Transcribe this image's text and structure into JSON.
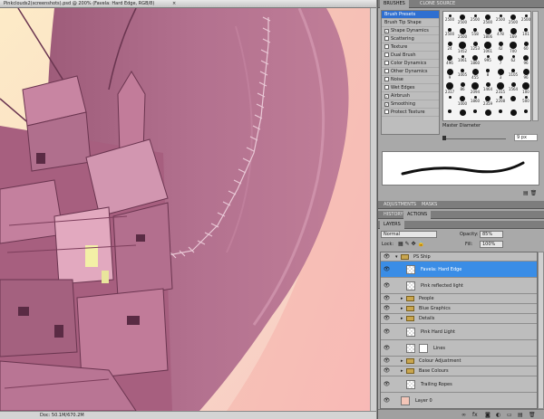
{
  "document": {
    "title": "Pinkclouds2(screenshots).psd @ 200% (Favela: Hard Edge, RGB/8)",
    "close": "×",
    "status_zoom": "",
    "status_doc": "Doc: 50.1M/670.2M"
  },
  "brushes_panel": {
    "tabs": [
      "BRUSHES",
      "CLONE SOURCE"
    ],
    "options": [
      {
        "label": "Brush Presets",
        "selected": true,
        "checkbox": false
      },
      {
        "label": "Brush Tip Shape",
        "checkbox": false
      },
      {
        "label": "Shape Dynamics",
        "checked": true,
        "checkbox": true
      },
      {
        "label": "Scattering",
        "checked": false,
        "checkbox": true
      },
      {
        "label": "Texture",
        "checked": false,
        "checkbox": true
      },
      {
        "label": "Dual Brush",
        "checked": false,
        "checkbox": true
      },
      {
        "label": "Color Dynamics",
        "checked": false,
        "checkbox": true
      },
      {
        "label": "Other Dynamics",
        "checked": false,
        "checkbox": true
      },
      {
        "label": "Noise",
        "checked": false,
        "checkbox": true
      },
      {
        "label": "Wet Edges",
        "checked": false,
        "checkbox": true
      },
      {
        "label": "Airbrush",
        "checked": true,
        "checkbox": true
      },
      {
        "label": "Smoothing",
        "checked": true,
        "checkbox": true
      },
      {
        "label": "Protect Texture",
        "checked": false,
        "checkbox": true
      }
    ],
    "brush_sizes": [
      [
        "2500",
        "2500",
        "2500",
        "2500",
        "2500",
        "2500",
        "2500"
      ],
      [
        "2500",
        "2500",
        "558",
        "1806",
        "478",
        "169",
        "101"
      ],
      [
        "24",
        "1452",
        "1253",
        "1061",
        "42",
        "700",
        "60"
      ],
      [
        "496",
        "1061",
        "1860",
        "995",
        "7",
        "62",
        "96"
      ],
      [
        "9",
        "1005",
        "455",
        "8",
        "3",
        "1105",
        "96"
      ],
      [
        "2317",
        "86",
        "2094",
        "1464",
        "2315",
        "1564",
        "100"
      ],
      [
        "",
        "1000",
        "1860",
        "2359",
        "2208",
        "",
        "500"
      ],
      [
        "",
        "",
        "",
        "",
        "",
        "",
        ""
      ]
    ],
    "master_diameter_label": "Master Diameter",
    "master_diameter_value": "9 px"
  },
  "adjustments_tabs": [
    "ADJUSTMENTS",
    "MASKS"
  ],
  "history_tabs": [
    "HISTORY",
    "ACTIONS"
  ],
  "layers_panel": {
    "tab": "LAYERS",
    "blend_mode": "Normal",
    "opacity_label": "Opacity:",
    "opacity_value": "85%",
    "lock_label": "Lock:",
    "fill_label": "Fill:",
    "fill_value": "100%",
    "layers": [
      {
        "name": "PS Ship",
        "type": "group",
        "indent": 0
      },
      {
        "name": "Favela: Hard Edge",
        "type": "layer",
        "indent": 1,
        "selected": true
      },
      {
        "name": "Pink reflected light",
        "type": "layer",
        "indent": 1
      },
      {
        "name": "People",
        "type": "group",
        "indent": 1
      },
      {
        "name": "Blue Graphics",
        "type": "group",
        "indent": 1
      },
      {
        "name": "Details",
        "type": "group",
        "indent": 1
      },
      {
        "name": "Pink Hard Light",
        "type": "layer",
        "indent": 1
      },
      {
        "name": "Lines",
        "type": "masked-layer",
        "indent": 1
      },
      {
        "name": "Colour Adjustment",
        "type": "group",
        "indent": 1
      },
      {
        "name": "Base Colours",
        "type": "group",
        "indent": 1
      },
      {
        "name": "Trailing Ropes",
        "type": "layer",
        "indent": 1
      },
      {
        "name": "Layer 0",
        "type": "layer",
        "indent": 0
      }
    ]
  },
  "colors": {
    "canvas_pink": "#d98aa8",
    "sky_cream": "#fbe3c3",
    "selection_blue": "#3a8de6"
  }
}
